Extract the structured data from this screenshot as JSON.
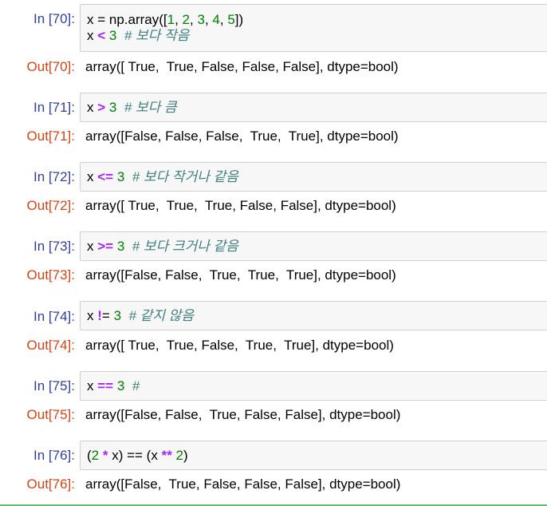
{
  "cells": [
    {
      "in_prompt": "In [70]:",
      "out_prompt": "Out[70]:",
      "line1": {
        "pre": "x = np.array([",
        "n1": "1",
        ",1": ", ",
        "n2": "2",
        ",2": ", ",
        "n3": "3",
        ",3": ", ",
        "n4": "4",
        ",4": ", ",
        "n5": "5",
        "post": "])"
      },
      "line2": {
        "var": "x ",
        "op": "<",
        "sp": " ",
        "num": "3",
        "sp2": "  ",
        "comment": "# 보다 작음"
      },
      "output": "array([ True,  True, False, False, False], dtype=bool)"
    },
    {
      "in_prompt": "In [71]:",
      "out_prompt": "Out[71]:",
      "code": {
        "var": "x ",
        "op": ">",
        "sp": " ",
        "num": "3",
        "sp2": "  ",
        "comment": "# 보다 큼"
      },
      "output": "array([False, False, False,  True,  True], dtype=bool)"
    },
    {
      "in_prompt": "In [72]:",
      "out_prompt": "Out[72]:",
      "code": {
        "var": "x ",
        "op": "<=",
        "sp": " ",
        "num": "3",
        "sp2": "  ",
        "comment": "# 보다 작거나 같음"
      },
      "output": "array([ True,  True,  True, False, False], dtype=bool)"
    },
    {
      "in_prompt": "In [73]:",
      "out_prompt": "Out[73]:",
      "code": {
        "var": "x ",
        "op": ">=",
        "sp": " ",
        "num": "3",
        "sp2": "  ",
        "comment": "# 보다 크거나 같음"
      },
      "output": "array([False, False,  True,  True,  True], dtype=bool)"
    },
    {
      "in_prompt": "In [74]:",
      "out_prompt": "Out[74]:",
      "code": {
        "var": "x ",
        "op": "!",
        "op2": "=",
        "sp": " ",
        "num": "3",
        "sp2": "  ",
        "comment": "# 같지 않음"
      },
      "output": "array([ True,  True, False,  True,  True], dtype=bool)"
    },
    {
      "in_prompt": "In [75]:",
      "out_prompt": "Out[75]:",
      "code": {
        "var": "x ",
        "op": "==",
        "sp": " ",
        "num": "3",
        "sp2": "  ",
        "comment": "#"
      },
      "output": "array([False, False,  True, False, False], dtype=bool)"
    },
    {
      "in_prompt": "In [76]:",
      "out_prompt": "Out[76]:",
      "code76": {
        "p1": "(",
        "n1": "2",
        "s1": " ",
        "op1": "*",
        "s2": " x) == (x ",
        "op2": "**",
        "s3": " ",
        "n2": "2",
        "p2": ")"
      },
      "output": "array([False,  True, False, False, False], dtype=bool)"
    }
  ],
  "colors": {
    "in_prompt": "#303f9f",
    "out_prompt": "#d84315",
    "number": "#008000",
    "operator": "#aa22ff",
    "comment": "#408080"
  }
}
